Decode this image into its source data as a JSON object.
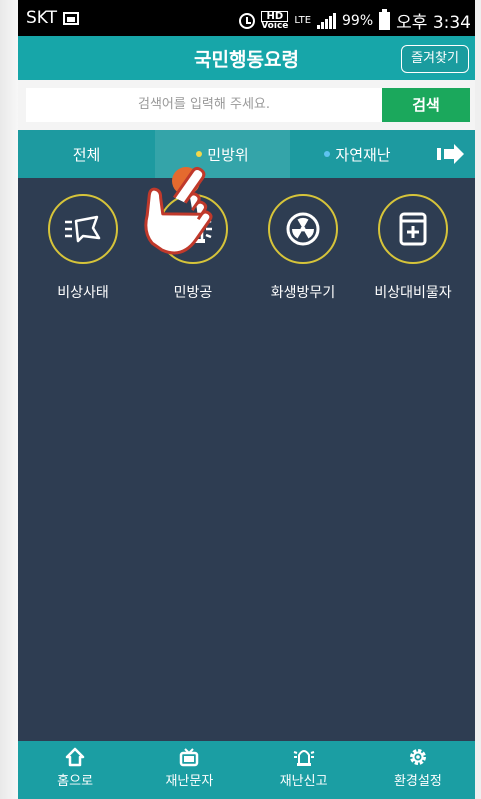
{
  "status_bar": {
    "carrier": "SKT",
    "hd": "HD",
    "voice": "Voice",
    "network": "LTE",
    "battery": "99%",
    "time": "오후 3:34"
  },
  "header": {
    "title": "국민행동요령",
    "favorites_label": "즐겨찾기"
  },
  "search": {
    "placeholder": "검색어를 입력해 주세요.",
    "button_label": "검색"
  },
  "tabs": [
    {
      "label": "전체",
      "selected": false
    },
    {
      "label": "민방위",
      "selected": true,
      "dot_color": "#f2d84a"
    },
    {
      "label": "자연재난",
      "selected": false,
      "dot_color": "#5ec3f0"
    },
    {
      "icon": "arrow-right-icon"
    }
  ],
  "items": [
    {
      "label": "비상사태",
      "icon": "megaphone-icon"
    },
    {
      "label": "민방공",
      "icon": "siren-icon"
    },
    {
      "label": "화생방무기",
      "icon": "radiation-icon"
    },
    {
      "label": "비상대비물자",
      "icon": "supplies-icon"
    }
  ],
  "bottom_nav": [
    {
      "label": "홈으로",
      "icon": "home-icon"
    },
    {
      "label": "재난문자",
      "icon": "tv-icon"
    },
    {
      "label": "재난신고",
      "icon": "siren-icon"
    },
    {
      "label": "환경설정",
      "icon": "gear-icon"
    }
  ],
  "colors": {
    "teal": "#17a6a9",
    "background": "#2e3d52",
    "search_green": "#1ba85c",
    "icon_ring": "#d6c43a"
  }
}
